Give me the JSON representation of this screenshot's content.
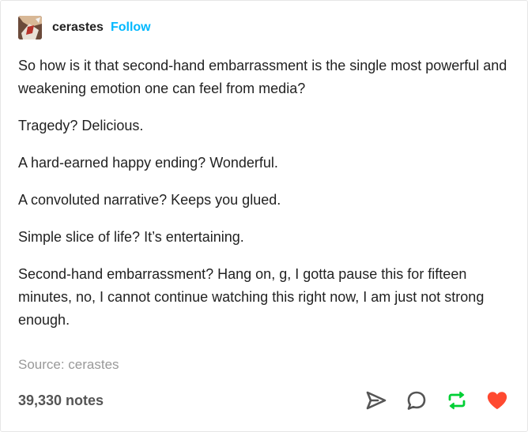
{
  "post": {
    "author": "cerastes",
    "follow_label": "Follow",
    "paragraphs": [
      "So how is it that second-hand embarrassment is the single most powerful and weakening emotion one can feel from media?",
      "Tragedy? Delicious.",
      "A hard-earned happy ending? Wonderful.",
      "A convoluted narrative? Keeps you glued.",
      "Simple slice of life? It’s entertaining.",
      "Second-hand embarrassment? Hang on, g, I gotta pause this for fifteen minutes, no, I cannot continue watching this right now, I am just not strong enough."
    ],
    "source": "Source: cerastes",
    "notes": "39,330 notes"
  },
  "icons": {
    "share": "share-icon",
    "reply": "reply-icon",
    "reblog": "reblog-icon",
    "like": "heart-icon"
  },
  "colors": {
    "follow": "#00b8ff",
    "reblog": "#00cf35",
    "like": "#ff4930",
    "muted": "#999999"
  }
}
